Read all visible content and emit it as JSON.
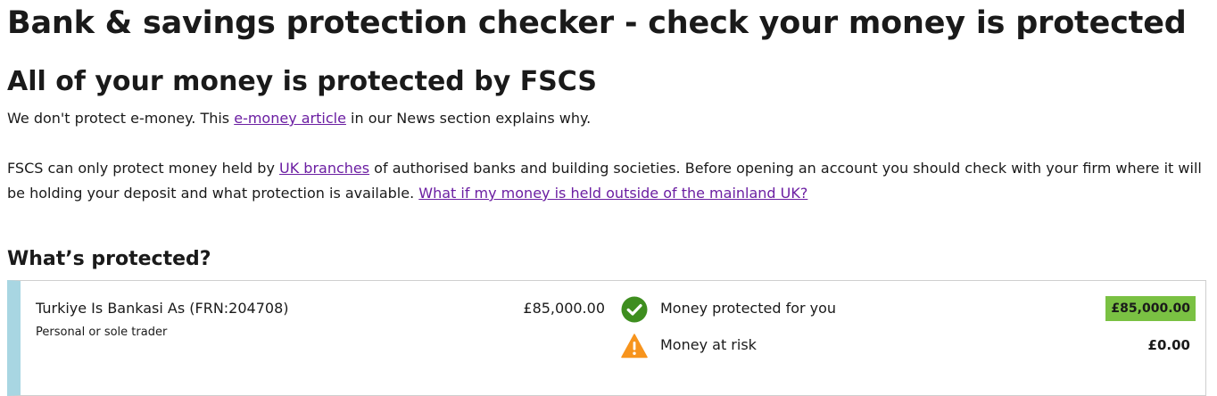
{
  "page": {
    "title": "Bank & savings protection checker - check your money is protected"
  },
  "result": {
    "heading": "All of your money is protected by FSCS",
    "emoney": {
      "text_before": "We don't protect e-money. This ",
      "link": "e-money article",
      "text_after": " in our News section explains why."
    },
    "branches": {
      "text_before": "FSCS can only protect money held by ",
      "link": "UK branches",
      "text_middle": " of authorised banks and building societies. Before opening an account you should check with your firm where it will be holding your deposit and what protection is available. ",
      "outside_link": "What if my money is held outside of the mainland UK?"
    }
  },
  "protected_section": {
    "heading": "What’s protected?",
    "entry": {
      "firm_name": "Turkiye Is Bankasi As (FRN:204708)",
      "firm_type": "Personal or sole trader",
      "amount": "£85,000.00",
      "protected_label": "Money protected for you",
      "protected_value": "£85,000.00",
      "risk_label": "Money at risk",
      "risk_value": "£0.00",
      "icons": {
        "protected": "check-circle-icon",
        "risk": "warning-triangle-icon"
      },
      "colors": {
        "accent_bar": "#a8d6e2",
        "protected_badge": "#7ac143",
        "check_icon": "#3e8e1f",
        "warning_icon": "#f7941d",
        "link": "#6b1ea2"
      }
    }
  }
}
